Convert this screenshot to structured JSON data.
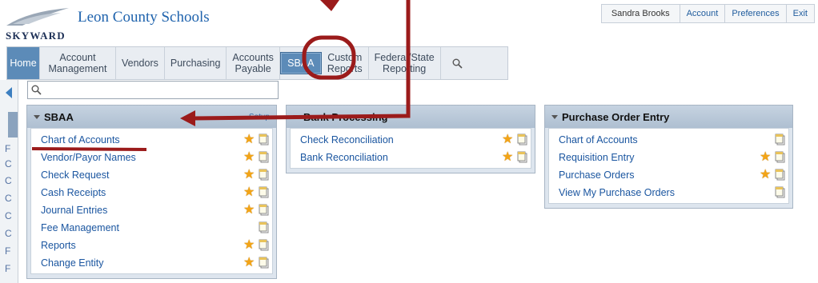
{
  "header": {
    "brand_text": "SKYWARD",
    "school_name": "Leon County Schools",
    "user_name": "Sandra Brooks",
    "links": [
      "Account",
      "Preferences",
      "Exit"
    ]
  },
  "nav": {
    "tabs": [
      {
        "label": "Home"
      },
      {
        "label": "Account\nManagement"
      },
      {
        "label": "Vendors"
      },
      {
        "label": "Purchasing"
      },
      {
        "label": "Accounts\nPayable"
      },
      {
        "label": "SBAA"
      },
      {
        "label": "Custom\nReports"
      },
      {
        "label": "Federal/State\nReporting"
      }
    ],
    "search_icon": "magnifier-icon"
  },
  "left_rail_letters": [
    "F",
    "C",
    "C",
    "C",
    "C",
    "C",
    "F",
    "F"
  ],
  "panels": [
    {
      "title": "SBAA",
      "setup_label": "Setup",
      "items": [
        {
          "label": "Chart of Accounts",
          "star": true,
          "page": true
        },
        {
          "label": "Vendor/Payor Names",
          "star": true,
          "page": true
        },
        {
          "label": "Check Request",
          "star": true,
          "page": true
        },
        {
          "label": "Cash Receipts",
          "star": true,
          "page": true
        },
        {
          "label": "Journal Entries",
          "star": true,
          "page": true
        },
        {
          "label": "Fee Management",
          "star": false,
          "page": true
        },
        {
          "label": "Reports",
          "star": true,
          "page": true
        },
        {
          "label": "Change Entity",
          "star": true,
          "page": true
        }
      ]
    },
    {
      "title": "Bank Processing",
      "items": [
        {
          "label": "Check Reconciliation",
          "star": true,
          "page": true
        },
        {
          "label": "Bank Reconciliation",
          "star": true,
          "page": true
        }
      ]
    },
    {
      "title": "Purchase Order Entry",
      "items": [
        {
          "label": "Chart of Accounts",
          "star": false,
          "page": true
        },
        {
          "label": "Requisition Entry",
          "star": true,
          "page": true
        },
        {
          "label": "Purchase Orders",
          "star": true,
          "page": true
        },
        {
          "label": "View My Purchase Orders",
          "star": false,
          "page": true
        }
      ]
    }
  ],
  "colors": {
    "accent_tab": "#5c8bb8",
    "link": "#1b56a0",
    "annotation": "#9b1b1b"
  }
}
